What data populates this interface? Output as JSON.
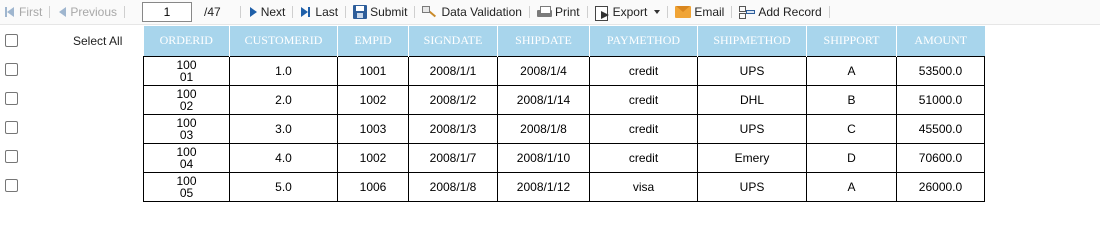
{
  "toolbar": {
    "first": "First",
    "previous": "Previous",
    "page_value": "1",
    "page_total": "/47",
    "next": "Next",
    "last": "Last",
    "submit": "Submit",
    "data_validation": "Data Validation",
    "print": "Print",
    "export": "Export",
    "email": "Email",
    "add_record": "Add Record"
  },
  "select_all_label": "Select All",
  "grid": {
    "header_color": "#a8d5ec",
    "columns": [
      "ORDERID",
      "CUSTOMERID",
      "EMPID",
      "SIGNDATE",
      "SHIPDATE",
      "PAYMETHOD",
      "SHIPMETHOD",
      "SHIPPORT",
      "AMOUNT"
    ],
    "rows": [
      [
        "10001",
        "1.0",
        "1001",
        "2008/1/1",
        "2008/1/4",
        "credit",
        "UPS",
        "A",
        "53500.0"
      ],
      [
        "10002",
        "2.0",
        "1002",
        "2008/1/2",
        "2008/1/14",
        "credit",
        "DHL",
        "B",
        "51000.0"
      ],
      [
        "10003",
        "3.0",
        "1003",
        "2008/1/3",
        "2008/1/8",
        "credit",
        "UPS",
        "C",
        "45500.0"
      ],
      [
        "10004",
        "4.0",
        "1002",
        "2008/1/7",
        "2008/1/10",
        "credit",
        "Emery",
        "D",
        "70600.0"
      ],
      [
        "10005",
        "5.0",
        "1006",
        "2008/1/8",
        "2008/1/12",
        "visa",
        "UPS",
        "A",
        "26000.0"
      ]
    ]
  }
}
